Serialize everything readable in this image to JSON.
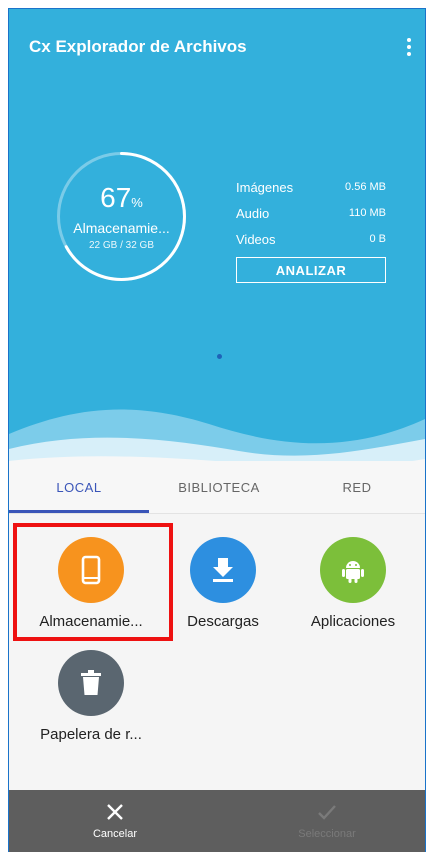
{
  "app": {
    "title": "Cx Explorador de Archivos"
  },
  "storage": {
    "percent": "67",
    "percent_symbol": "%",
    "percent_value": 67,
    "label": "Almacenamie...",
    "size": "22 GB / 32 GB"
  },
  "stats": [
    {
      "label": "Imágenes",
      "value": "0.56 MB"
    },
    {
      "label": "Audio",
      "value": "110 MB"
    },
    {
      "label": "Videos",
      "value": "0 B"
    }
  ],
  "analyze_label": "ANALIZAR",
  "tabs": [
    {
      "label": "LOCAL",
      "active": true
    },
    {
      "label": "BIBLIOTECA",
      "active": false
    },
    {
      "label": "RED",
      "active": false
    }
  ],
  "items": [
    {
      "label": "Almacenamie...",
      "icon": "phone-icon",
      "color": "#f7931e"
    },
    {
      "label": "Descargas",
      "icon": "download-icon",
      "color": "#2d8fe0"
    },
    {
      "label": "Aplicaciones",
      "icon": "android-icon",
      "color": "#7cbf3a"
    },
    {
      "label": "Papelera de r...",
      "icon": "trash-icon",
      "color": "#5a6670"
    }
  ],
  "bottom": {
    "cancel": "Cancelar",
    "select": "Seleccionar"
  },
  "colors": {
    "hero": "#33b0dc",
    "accent": "#3a55b8",
    "highlight": "#ee1111"
  }
}
